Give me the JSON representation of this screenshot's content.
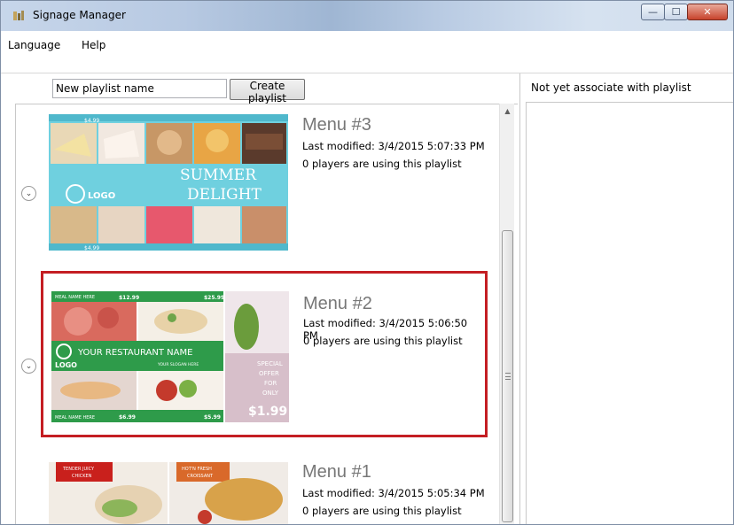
{
  "window": {
    "title": "Signage Manager",
    "controls": {
      "minimize": "—",
      "maximize": "☐",
      "close": "✕"
    }
  },
  "menu": {
    "items": [
      "Language",
      "Help"
    ]
  },
  "toolbar": {
    "playlist_name_value": "New playlist name",
    "create_label": "Create playlist"
  },
  "right_panel": {
    "header": "Not yet associate with playlist"
  },
  "playlists": [
    {
      "title": "Menu #3",
      "modified": "Last modified: 3/4/2015 5:07:33 PM",
      "usage": "0 players are using this playlist",
      "selected": false,
      "thumbnail": {
        "texts": [
          "SUMMER",
          "DELIGHT",
          "LOGO",
          "$4.99"
        ],
        "accent": "#5bc3d6"
      }
    },
    {
      "title": "Menu #2",
      "modified": "Last modified: 3/4/2015 5:06:50 PM",
      "usage": "0 players are using this playlist",
      "selected": true,
      "thumbnail": {
        "texts": [
          "YOUR RESTAURANT NAME",
          "LOGO",
          "YOUR SLOGAN HERE",
          "MEAL NAME HERE",
          "$12.99",
          "$25.99",
          "$6.99",
          "$5.99",
          "SPECIAL",
          "OFFER",
          "FOR",
          "ONLY",
          "$1.99"
        ],
        "accent": "#2e9b4a"
      }
    },
    {
      "title": "Menu #1",
      "modified": "Last modified: 3/4/2015 5:05:34 PM",
      "usage": "0 players are using this playlist",
      "selected": false,
      "thumbnail": {
        "texts": [
          "TENDER JUICY",
          "CHICKEN",
          "HOT'N FRESH",
          "CROISSANT"
        ],
        "accent": "#c9201c"
      }
    }
  ],
  "colors": {
    "selection_border": "#c41e23",
    "title_gray": "#777777"
  }
}
